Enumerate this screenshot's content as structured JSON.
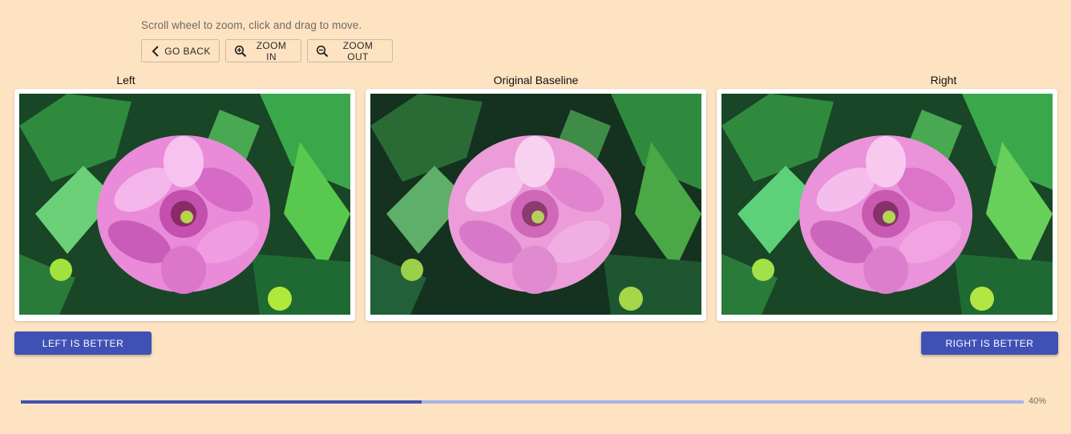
{
  "instructions": "Scroll wheel to zoom, click and drag to move.",
  "toolbar": {
    "go_back_label": "GO BACK",
    "zoom_in_label": "ZOOM IN",
    "zoom_out_label": "ZOOM OUT"
  },
  "panels": {
    "left_label": "Left",
    "center_label": "Original Baseline",
    "right_label": "Right"
  },
  "actions": {
    "left_better_label": "LEFT IS BETTER",
    "right_better_label": "RIGHT IS BETTER"
  },
  "progress": {
    "value": 0.4,
    "text": "40%"
  },
  "colors": {
    "background": "#fde3c1",
    "accent": "#3f51b5",
    "progress_track": "#a8b3e6"
  },
  "images": {
    "subject": "pink dahlia flower with green leaves and buds",
    "left_style": "posterized",
    "center_style": "original",
    "right_style": "posterized"
  }
}
